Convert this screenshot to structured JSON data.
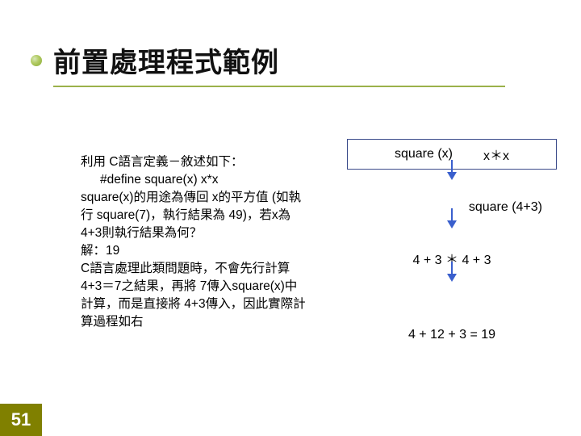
{
  "slide": {
    "title": "前置處理程式範例",
    "body": {
      "line1": "利用 C語言定義－敘述如下：",
      "line2": "#define square(x) x*x",
      "line3": "square(x)的用途為傳回 x的平方值 (如執行 square(7)，執行結果為 49)，若x為 4+3則執行結果為何？",
      "line4": "解：19",
      "line5": "C語言處理此類問題時，不會先行計算 4+3＝7之結果，再將 7傳入square(x)中計算，而是直接將 4+3傳入，因此實際計算過程如右"
    },
    "diagram": {
      "box_left": "square (x)",
      "box_right_a": "x",
      "box_right_star": "＊",
      "box_right_b": "x",
      "step1": "square (4+3)",
      "step2_a": "4 + 3",
      "step2_star": "＊",
      "step2_b": "4 + 3",
      "final": "4 + 12 + 3 = 19"
    },
    "page_number": "51"
  }
}
